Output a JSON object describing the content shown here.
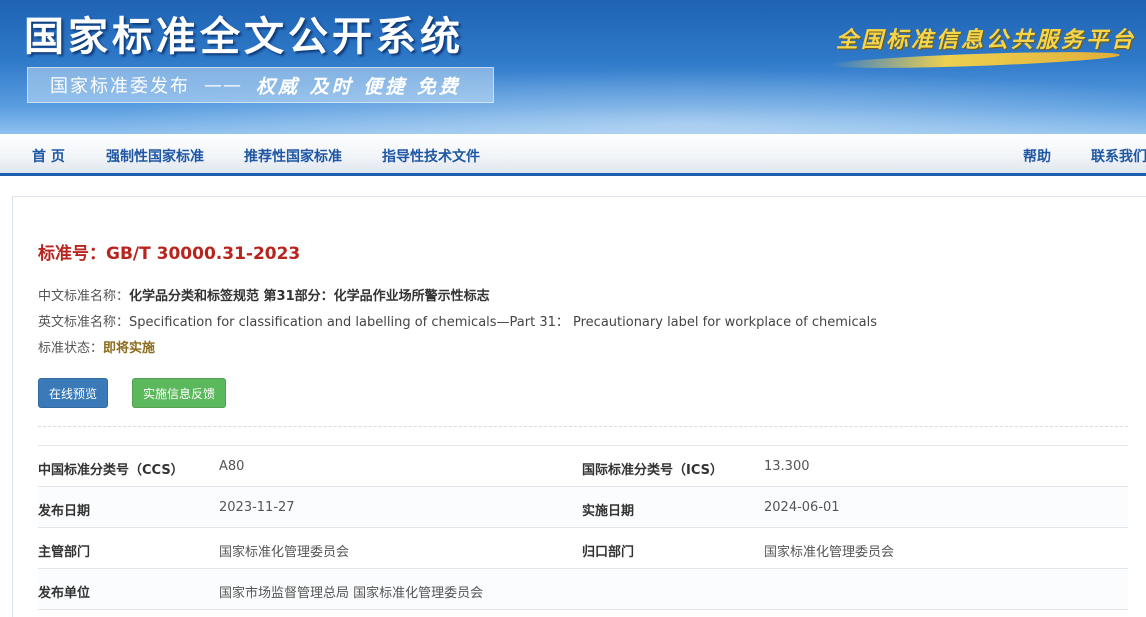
{
  "banner": {
    "title": "国家标准全文公开系统",
    "publisher": "国家标准委发布",
    "dash": "——",
    "tagline": "权威 及时 便捷 免费",
    "platform": "全国标准信息公共服务平台"
  },
  "nav": {
    "home": "首 页",
    "mandatory": "强制性国家标准",
    "recommended": "推荐性国家标准",
    "guidance": "指导性技术文件",
    "help": "帮助",
    "contact": "联系我们"
  },
  "standard": {
    "number": "标准号：GB/T 30000.31-2023",
    "cn_name_label": "中文标准名称：",
    "cn_name": "化学品分类和标签规范 第31部分：化学品作业场所警示性标志",
    "en_name_label": "英文标准名称：",
    "en_name": "Specification for classification and labelling of chemicals—Part 31： Precautionary label for workplace of chemicals",
    "status_label": "标准状态：",
    "status": "即将实施"
  },
  "buttons": {
    "preview": "在线预览",
    "feedback": "实施信息反馈"
  },
  "details": {
    "rows": [
      {
        "l1": "中国标准分类号（CCS）",
        "v1": "A80",
        "l2": "国际标准分类号（ICS）",
        "v2": "13.300"
      },
      {
        "l1": "发布日期",
        "v1": "2023-11-27",
        "l2": "实施日期",
        "v2": "2024-06-01"
      },
      {
        "l1": "主管部门",
        "v1": "国家标准化管理委员会",
        "l2": "归口部门",
        "v2": "国家标准化管理委员会"
      },
      {
        "l1": "发布单位",
        "v1": "国家市场监督管理总局 国家标准化管理委员会",
        "l2": "",
        "v2": ""
      }
    ]
  },
  "colors": {
    "accent_blue": "#1f57a4",
    "title_red": "#b8251f",
    "preview_btn": "#3a7ab9",
    "feedback_btn": "#5cb85c",
    "platform_gold": "#f6d54a"
  }
}
